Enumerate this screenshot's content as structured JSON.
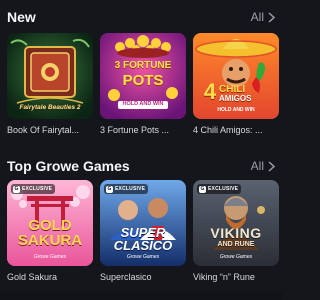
{
  "sections": [
    {
      "title": "New",
      "all_label": "All",
      "games": [
        {
          "caption": "Book Of Fairytal...",
          "tile_text": "Fairytale Beauties 2",
          "colors": [
            "#1f4a2a",
            "#0d2a18",
            "#c99a2e"
          ],
          "icon": "book-icon"
        },
        {
          "caption": "3 Fortune Pots ...",
          "tile_line1": "3 FORTUNE",
          "tile_line2": "POTS",
          "tile_line3": "HOLD AND WIN",
          "colors": [
            "#d42a86",
            "#7a1a8a",
            "#f7c21d"
          ],
          "icon": "pot-icon"
        },
        {
          "caption": "4 Chili Amigos: ...",
          "tile_line1": "4",
          "tile_line2": "CHILI",
          "tile_line3": "AMIGOS",
          "tile_line4": "HOLD AND WIN",
          "colors": [
            "#e44a3a",
            "#f2a13a",
            "#2c9bd6"
          ],
          "icon": "sombrero-icon"
        }
      ]
    },
    {
      "title": "Top Growe Games",
      "all_label": "All",
      "games": [
        {
          "caption": "Gold Sakura",
          "badge": "EXCLUSIVE",
          "tile_line1": "GOLD",
          "tile_line2": "SAKURA",
          "brand": "Growe Games",
          "colors": [
            "#f06aa8",
            "#ffd1e6",
            "#c2185b"
          ],
          "icon": "torii-gate-icon"
        },
        {
          "caption": "Superclasico",
          "badge": "EXCLUSIVE",
          "tile_line1": "SUPER",
          "tile_line2": "CLASICO",
          "brand": "Growe Games",
          "colors": [
            "#1b3f8f",
            "#4a8bd8",
            "#d9e8ff"
          ],
          "icon": "football-players-icon"
        },
        {
          "caption": "Viking “n” Rune",
          "badge": "EXCLUSIVE",
          "tile_line1": "VIKING",
          "tile_line2": "AND RUNE",
          "brand": "Growe Games",
          "colors": [
            "#3a3f4a",
            "#8a5a2c",
            "#c8b79a"
          ],
          "icon": "viking-warrior-icon"
        }
      ]
    }
  ],
  "colors": {
    "background": "#14161b",
    "title": "#f4f5f7",
    "muted": "#9aa0a8",
    "caption": "#d6d9de"
  }
}
